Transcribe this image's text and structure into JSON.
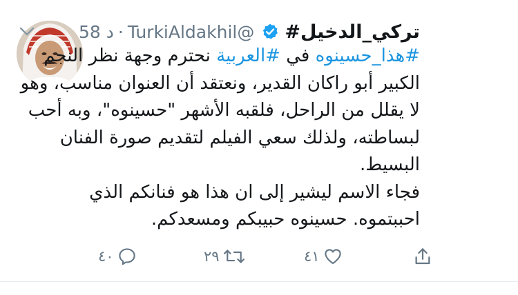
{
  "tweet": {
    "display_name": "تركي_الدخيل#",
    "handle": "@TurkiAldakhil",
    "separator": "·",
    "time": "58 د",
    "body": {
      "line1_prefix_hashtag": "#هذا_حسينوه",
      "line1_word_in": " في ",
      "line1_hashtag2": "#العربية",
      "line1_rest": " نحترم وجهة نظر النجم",
      "rest": "الكبير أبو راكان القدير، ونعتقد أن العنوان مناسب، وهو\nلا يقلل من الراحل، فلقبه الأشهر \"حسينوه\"، وبه أحب\nلبساطته، ولذلك سعي الفيلم لتقديم صورة الفنان\nالبسيط.\nفجاء الاسم ليشير إلى ان هذا هو فنانكم الذي\nاحببتموه. حسينوه حبيبكم ومسعدكم."
    },
    "actions": {
      "reply_count": "٤٠",
      "retweet_count": "٢٩",
      "like_count": "٤١"
    },
    "icons": {
      "verified": "verified-badge-icon",
      "chevron": "chevron-down-icon",
      "reply": "reply-icon",
      "retweet": "retweet-icon",
      "like": "heart-icon",
      "share": "share-icon"
    },
    "colors": {
      "accent": "#1da1f2",
      "hashtag": "#1b95e0",
      "muted": "#657786",
      "text": "#14171a"
    }
  }
}
